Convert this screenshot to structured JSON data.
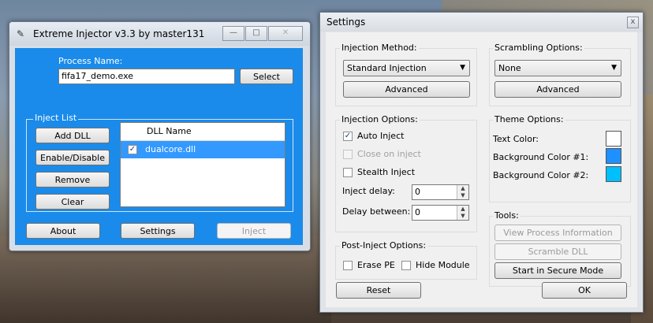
{
  "injector": {
    "title": "Extreme Injector v3.3 by master131",
    "process_label": "Process Name:",
    "process_value": "fifa17_demo.exe",
    "select_label": "Select",
    "inject_list_title": "Inject List",
    "buttons": {
      "add_dll": "Add DLL",
      "enable_disable": "Enable/Disable",
      "remove": "Remove",
      "clear": "Clear",
      "about": "About",
      "settings": "Settings",
      "inject": "Inject"
    },
    "list": {
      "column": "DLL Name",
      "rows": [
        {
          "name": "dualcore.dll",
          "checked": true
        }
      ]
    },
    "client_color": "#1a8bea"
  },
  "settings": {
    "title": "Settings",
    "close_glyph": "x",
    "injection_method": {
      "title": "Injection Method:",
      "selected": "Standard Injection",
      "advanced": "Advanced"
    },
    "scrambling": {
      "title": "Scrambling Options:",
      "selected": "None",
      "advanced": "Advanced"
    },
    "injection_options": {
      "title": "Injection Options:",
      "auto_inject": "Auto Inject",
      "close_on_inject": "Close on inject",
      "stealth_inject": "Stealth Inject",
      "inject_delay_label": "Inject delay:",
      "inject_delay_value": "0",
      "delay_between_label": "Delay between:",
      "delay_between_value": "0"
    },
    "theme": {
      "title": "Theme Options:",
      "text_color_label": "Text Color:",
      "bg1_label": "Background Color #1:",
      "bg2_label": "Background Color #2:",
      "text_color": "#ffffff",
      "bg1_color": "#1e90ff",
      "bg2_color": "#00bfff"
    },
    "tools": {
      "title": "Tools:",
      "view_process": "View Process Information",
      "scramble_dll": "Scramble DLL",
      "secure_mode": "Start in Secure Mode"
    },
    "post_inject": {
      "title": "Post-Inject Options:",
      "erase_pe": "Erase PE",
      "hide_module": "Hide Module"
    },
    "reset": "Reset",
    "ok": "OK"
  }
}
